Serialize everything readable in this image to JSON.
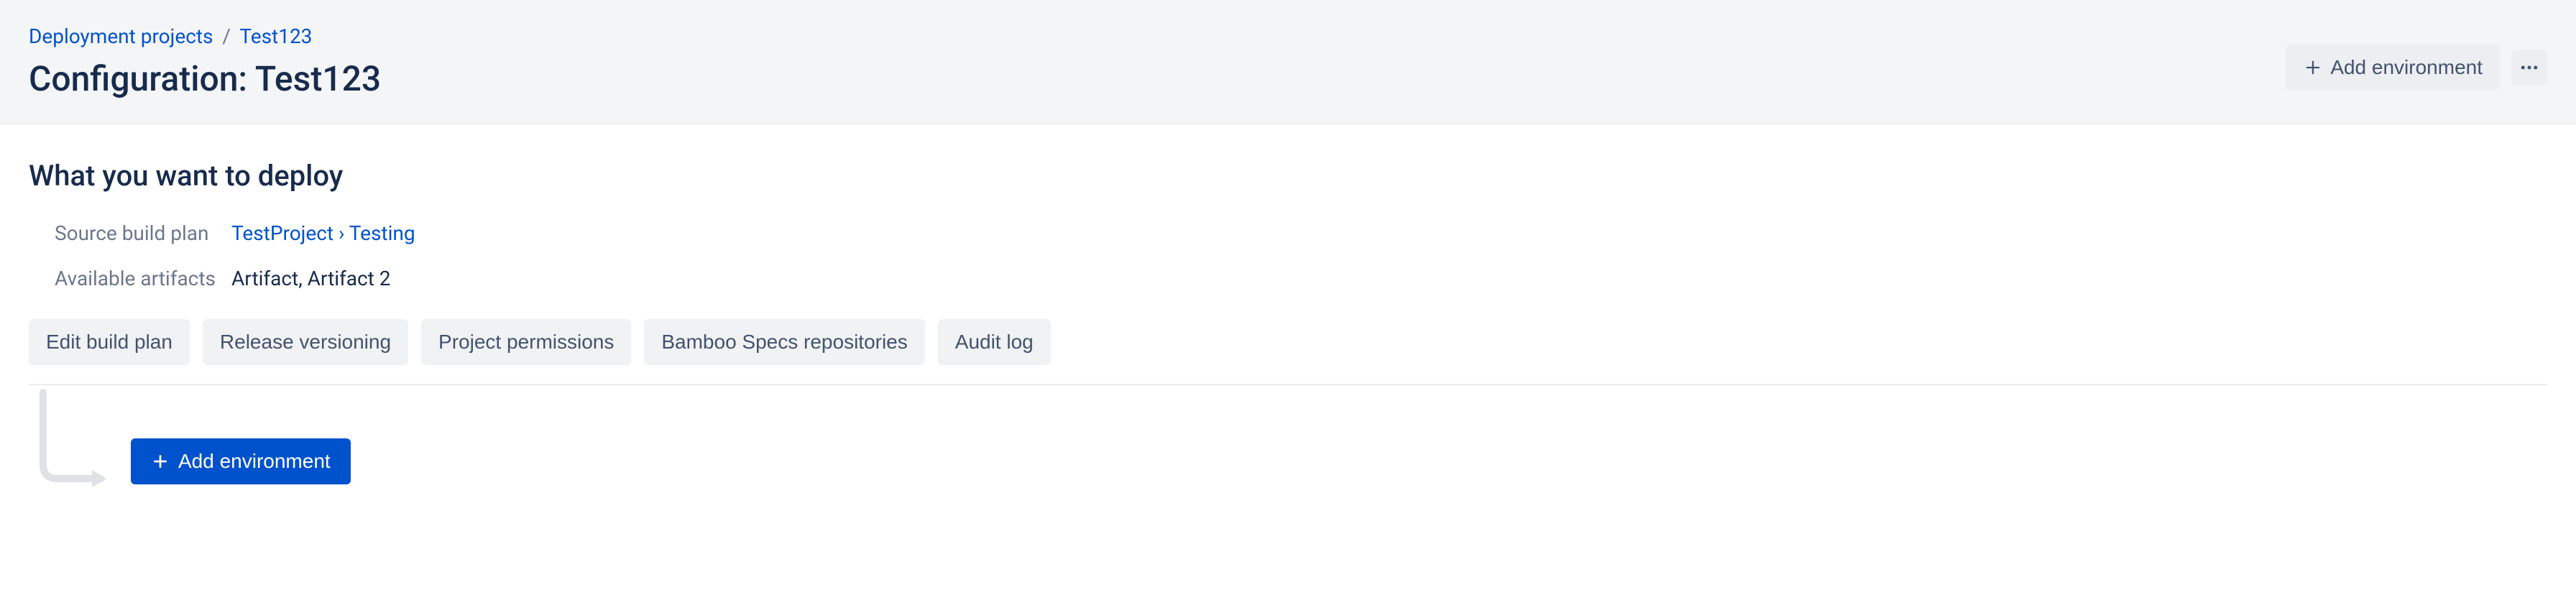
{
  "breadcrumb": {
    "items": [
      {
        "label": "Deployment projects"
      },
      {
        "label": "Test123"
      }
    ]
  },
  "page_title": "Configuration: Test123",
  "header_actions": {
    "add_environment": "Add environment"
  },
  "section": {
    "title": "What you want to deploy",
    "rows": {
      "source_build_plan": {
        "label": "Source build plan",
        "value": "TestProject › Testing"
      },
      "available_artifacts": {
        "label": "Available artifacts",
        "value": "Artifact, Artifact 2"
      }
    }
  },
  "buttons": {
    "edit_build_plan": "Edit build plan",
    "release_versioning": "Release versioning",
    "project_permissions": "Project permissions",
    "bamboo_specs_repositories": "Bamboo Specs repositories",
    "audit_log": "Audit log"
  },
  "flow": {
    "add_environment": "Add environment"
  }
}
